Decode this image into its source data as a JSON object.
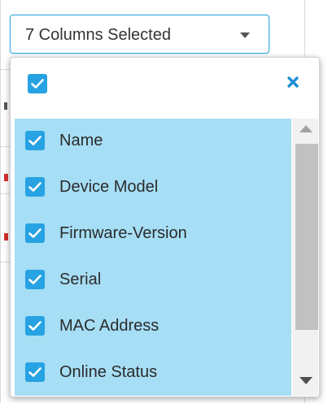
{
  "select": {
    "label": "7 Columns Selected"
  },
  "dropdown": {
    "select_all_checked": true,
    "close_icon": "close-x-icon",
    "items": [
      {
        "label": "Name",
        "checked": true
      },
      {
        "label": "Device Model",
        "checked": true
      },
      {
        "label": "Firmware-Version",
        "checked": true
      },
      {
        "label": "Serial",
        "checked": true
      },
      {
        "label": "MAC Address",
        "checked": true
      },
      {
        "label": "Online Status",
        "checked": true
      }
    ]
  },
  "colors": {
    "accent": "#27a2e2",
    "select_border": "#37a7de",
    "list_highlight": "#a6def5",
    "close_icon": "#1f8fd6",
    "scroll_thumb": "#c1c1c1"
  },
  "icons": {
    "caret": "chevron-down-icon",
    "checkbox_check": "check-icon",
    "scroll_up": "arrow-up-icon",
    "scroll_down": "arrow-down-icon"
  }
}
